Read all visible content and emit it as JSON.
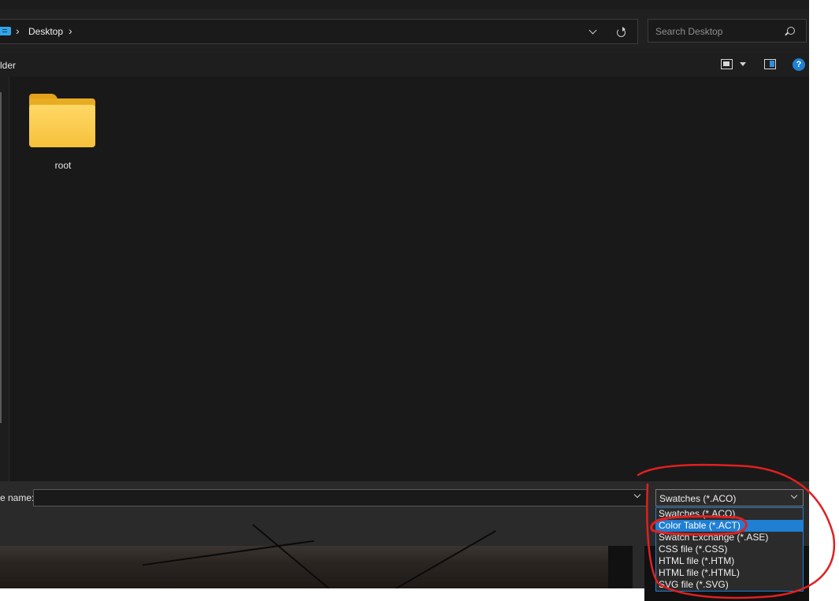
{
  "breadcrumb": {
    "items": [
      "Desktop"
    ]
  },
  "search": {
    "placeholder": "Search Desktop"
  },
  "toolbar": {
    "new_folder_label": "lder"
  },
  "files": [
    {
      "name": "root",
      "type": "folder"
    }
  ],
  "bottom": {
    "filename_label": "e name:",
    "filename_value": "",
    "filetype_value": "Swatches (*.ACO)"
  },
  "filetype_options": [
    {
      "label": "Swatches (*.ACO)",
      "selected": false
    },
    {
      "label": "Color Table (*.ACT)",
      "selected": true
    },
    {
      "label": "Swatch Exchange (*.ASE)",
      "selected": false
    },
    {
      "label": "CSS file (*.CSS)",
      "selected": false
    },
    {
      "label": "HTML file (*.HTM)",
      "selected": false
    },
    {
      "label": "HTML file (*.HTML)",
      "selected": false
    },
    {
      "label": "SVG file (*.SVG)",
      "selected": false
    }
  ],
  "colors": {
    "accent": "#1f7fd3",
    "annotation_red": "#e02020",
    "folder_yellow": "#f6c13c"
  },
  "icons": [
    "this-pc-icon",
    "chevron-right-icon",
    "chevron-down-icon",
    "refresh-icon",
    "search-icon",
    "view-options-icon",
    "preview-pane-icon",
    "help-icon",
    "folder-icon"
  ]
}
